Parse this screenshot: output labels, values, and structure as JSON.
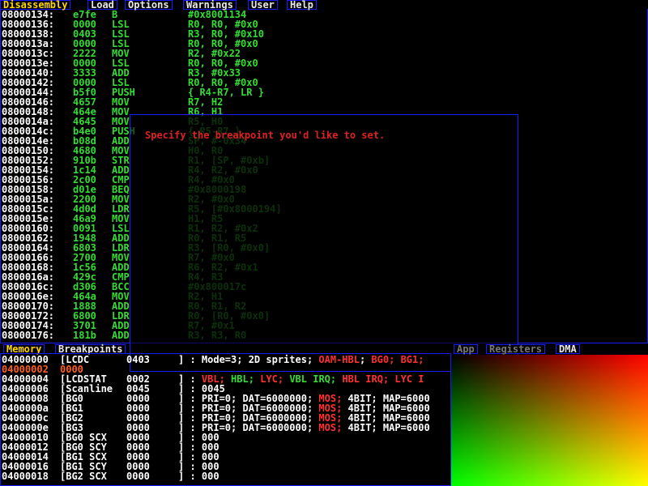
{
  "menu": {
    "tabs": [
      {
        "label": "Disassembly",
        "active": true
      },
      {
        "label": "Load",
        "active": false
      },
      {
        "label": "Options",
        "active": false
      },
      {
        "label": "Warnings",
        "active": false
      },
      {
        "label": "User",
        "active": false
      },
      {
        "label": "Help",
        "active": false
      }
    ]
  },
  "disassembly": [
    {
      "addr": "08000134:",
      "op": "e7fe",
      "mn": "B",
      "arg": "#0x8001134"
    },
    {
      "addr": "08000136:",
      "op": "0000",
      "mn": "LSL",
      "arg": "R0, R0, #0x0"
    },
    {
      "addr": "08000138:",
      "op": "0403",
      "mn": "LSL",
      "arg": "R3, R0, #0x10"
    },
    {
      "addr": "0800013a:",
      "op": "0000",
      "mn": "LSL",
      "arg": "R0, R0, #0x0"
    },
    {
      "addr": "0800013c:",
      "op": "2222",
      "mn": "MOV",
      "arg": "R2, #0x22"
    },
    {
      "addr": "0800013e:",
      "op": "0000",
      "mn": "LSL",
      "arg": "R0, R0, #0x0"
    },
    {
      "addr": "08000140:",
      "op": "3333",
      "mn": "ADD",
      "arg": "R3, #0x33"
    },
    {
      "addr": "08000142:",
      "op": "0000",
      "mn": "LSL",
      "arg": "R0, R0, #0x0"
    },
    {
      "addr": "08000144:",
      "op": "b5f0",
      "mn": "PUSH",
      "arg": "{ R4-R7, LR }"
    },
    {
      "addr": "08000146:",
      "op": "4657",
      "mn": "MOV",
      "arg": "R7, H2"
    },
    {
      "addr": "08000148:",
      "op": "464e",
      "mn": "MOV",
      "arg": "R6, H1"
    },
    {
      "addr": "0800014a:",
      "op": "4645",
      "mn": "MOV",
      "arg": "R5, H0"
    },
    {
      "addr": "0800014c:",
      "op": "b4e0",
      "mn": "PUSH",
      "arg": "{ R5-R7 }"
    },
    {
      "addr": "0800014e:",
      "op": "b08d",
      "mn": "ADD",
      "arg": "SP, #-0x34"
    },
    {
      "addr": "08000150:",
      "op": "4680",
      "mn": "MOV",
      "arg": "H0, R0"
    },
    {
      "addr": "08000152:",
      "op": "910b",
      "mn": "STR",
      "arg": "R1, [SP, #0xb]"
    },
    {
      "addr": "08000154:",
      "op": "1c14",
      "mn": "ADD",
      "arg": "R4, R2, #0x0"
    },
    {
      "addr": "08000156:",
      "op": "2c00",
      "mn": "CMP",
      "arg": "R4, #0x0"
    },
    {
      "addr": "08000158:",
      "op": "d01e",
      "mn": "BEQ",
      "arg": "#0x8000198"
    },
    {
      "addr": "0800015a:",
      "op": "2200",
      "mn": "MOV",
      "arg": "R2, #0x0"
    },
    {
      "addr": "0800015c:",
      "op": "4d0d",
      "mn": "LDR",
      "arg": "R5, [#0x8000194]"
    },
    {
      "addr": "0800015e:",
      "op": "46a9",
      "mn": "MOV",
      "arg": "H1, R5"
    },
    {
      "addr": "08000160:",
      "op": "0091",
      "mn": "LSL",
      "arg": "R1, R2, #0x2"
    },
    {
      "addr": "08000162:",
      "op": "1948",
      "mn": "ADD",
      "arg": "R0, R1, R5"
    },
    {
      "addr": "08000164:",
      "op": "6803",
      "mn": "LDR",
      "arg": "R3, [R0, #0x0]"
    },
    {
      "addr": "08000166:",
      "op": "2700",
      "mn": "MOV",
      "arg": "R7, #0x0"
    },
    {
      "addr": "08000168:",
      "op": "1c56",
      "mn": "ADD",
      "arg": "R6, R2, #0x1"
    },
    {
      "addr": "0800016a:",
      "op": "429c",
      "mn": "CMP",
      "arg": "R4, R3"
    },
    {
      "addr": "0800016c:",
      "op": "d306",
      "mn": "BCC",
      "arg": "#0x800017c"
    },
    {
      "addr": "0800016e:",
      "op": "464a",
      "mn": "MOV",
      "arg": "R2, H1"
    },
    {
      "addr": "08000170:",
      "op": "1888",
      "mn": "ADD",
      "arg": "R0, R1, R2"
    },
    {
      "addr": "08000172:",
      "op": "6800",
      "mn": "LDR",
      "arg": "R0, [R0, #0x0]"
    },
    {
      "addr": "08000174:",
      "op": "3701",
      "mn": "ADD",
      "arg": "R7, #0x1"
    },
    {
      "addr": "08000176:",
      "op": "181b",
      "mn": "ADD",
      "arg": "R3, R3, R0"
    }
  ],
  "dialog": {
    "message": "Specify the breakpoint you'd like to set."
  },
  "bottom_tabs_left": [
    {
      "label": "Memory",
      "active": true
    },
    {
      "label": "Breakpoints",
      "active": false
    }
  ],
  "bottom_tabs_right": [
    {
      "label": "App",
      "active": false
    },
    {
      "label": "Registers",
      "active": false
    },
    {
      "label": "DMA",
      "active": false
    }
  ],
  "memory": [
    {
      "addr": "04000000",
      "name": "[LCDC",
      "val": "0403",
      "desc": "] : Mode=3; 2D sprites; OAM-HBL; BG0; BG1;"
    },
    {
      "addr": "04000002",
      "name": "0000",
      "val": "",
      "desc": "",
      "highlight": true
    },
    {
      "addr": "04000004",
      "name": "[LCDSTAT",
      "val": "0002",
      "desc": "] : VBL; HBL; LYC; VBL IRQ; HBL IRQ; LYC I"
    },
    {
      "addr": "04000006",
      "name": "[Scanline",
      "val": "0045",
      "desc": "] : 0045"
    },
    {
      "addr": "04000008",
      "name": "[BG0",
      "val": "0000",
      "desc": "] : PRI=0; DAT=6000000; MOS; 4BIT; MAP=6000"
    },
    {
      "addr": "0400000a",
      "name": "[BG1",
      "val": "0000",
      "desc": "] : PRI=0; DAT=6000000; MOS; 4BIT; MAP=6000"
    },
    {
      "addr": "0400000c",
      "name": "[BG2",
      "val": "0000",
      "desc": "] : PRI=0; DAT=6000000; MOS; 4BIT; MAP=6000"
    },
    {
      "addr": "0400000e",
      "name": "[BG3",
      "val": "0000",
      "desc": "] : PRI=0; DAT=6000000; MOS; 4BIT; MAP=6000"
    },
    {
      "addr": "04000010",
      "name": "[BG0 SCX",
      "val": "0000",
      "desc": "] : 000"
    },
    {
      "addr": "04000012",
      "name": "[BG0 SCY",
      "val": "0000",
      "desc": "] : 000"
    },
    {
      "addr": "04000014",
      "name": "[BG1 SCX",
      "val": "0000",
      "desc": "] : 000"
    },
    {
      "addr": "04000016",
      "name": "[BG1 SCY",
      "val": "0000",
      "desc": "] : 000"
    },
    {
      "addr": "04000018",
      "name": "[BG2 SCX",
      "val": "0000",
      "desc": "] : 000"
    }
  ],
  "colors": {
    "border": "#1a1aff",
    "active_tab": "#ffd700",
    "code": "#33dd33",
    "error": "#dd2222"
  }
}
